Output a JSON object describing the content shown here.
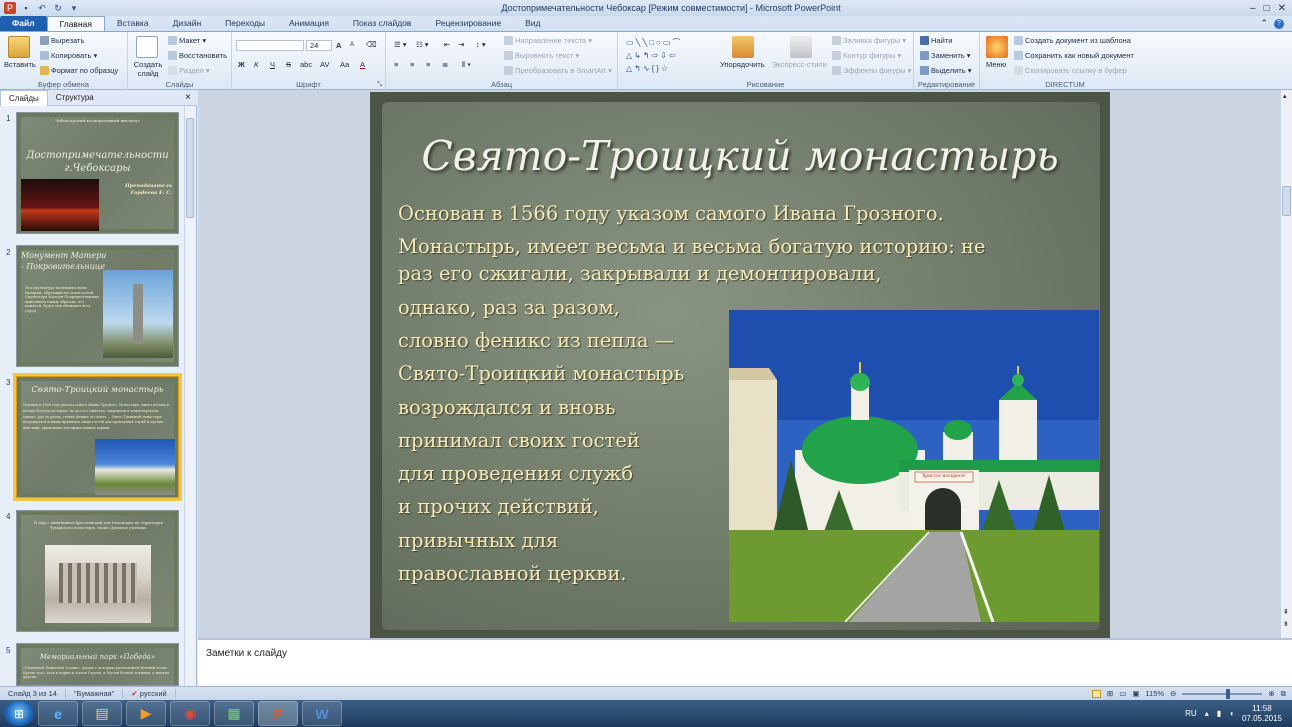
{
  "window": {
    "title": "Достопримечательности Чебоксар [Режим совместимости]  -  Microsoft PowerPoint"
  },
  "tabs": [
    {
      "label": "Файл"
    },
    {
      "label": "Главная"
    },
    {
      "label": "Вставка"
    },
    {
      "label": "Дизайн"
    },
    {
      "label": "Переходы"
    },
    {
      "label": "Анимация"
    },
    {
      "label": "Показ слайдов"
    },
    {
      "label": "Рецензирование"
    },
    {
      "label": "Вид"
    }
  ],
  "ribbon": {
    "clipboard": {
      "paste": "Вставить",
      "cut": "Вырезать",
      "copy": "Копировать",
      "format_painter": "Формат по образцу",
      "label": "Буфер обмена"
    },
    "slides": {
      "new_slide": "Создать слайд",
      "layout": "Макет",
      "reset": "Восстановить",
      "section": "Раздел",
      "label": "Слайды"
    },
    "font": {
      "size": "24",
      "label": "Шрифт",
      "bold": "Ж",
      "italic": "К",
      "underline": "Ч",
      "strike": "S",
      "shadow": "abc",
      "spacing": "AV",
      "case": "Aa",
      "color": "A",
      "grow": "A",
      "shrink": "A"
    },
    "paragraph": {
      "text_direction": "Направление текста",
      "align_text": "Выровнять текст",
      "smartart": "Преобразовать в SmartArt",
      "label": "Абзац"
    },
    "drawing": {
      "arrange": "Упорядочить",
      "quick_styles": "Экспресс-стили",
      "shape_fill": "Заливка фигуры",
      "shape_outline": "Контур фигуры",
      "shape_effects": "Эффекты фигуры",
      "label": "Рисование"
    },
    "editing": {
      "find": "Найти",
      "replace": "Заменить",
      "select": "Выделить",
      "label": "Редактирование"
    },
    "directum": {
      "menu": "Меню",
      "create_from_template": "Создать документ из шаблона",
      "save_new": "Сохранить как новый документ",
      "copy_link": "Скопировать ссылку в буфер",
      "label": "DIRECTUM"
    }
  },
  "left_panel": {
    "tab_slides": "Слайды",
    "tab_outline": "Структура",
    "close": "×",
    "thumbnails": [
      {
        "num": "1",
        "header": "Чебоксарский кооперативный институт",
        "title": "Достопримечательности г.Чебоксары",
        "author_label": "Преподаватель",
        "author": "Гордеева Е. С."
      },
      {
        "num": "2",
        "title": "Монумент Матери - Покровительнице",
        "text": "Эта скульптура посвящена всем матерям, обретшим на земле детей. Скульптура Матери-Покровительницы выполнена таким образом, что кажется, будто она обнимает весь город."
      },
      {
        "num": "3",
        "title": "Свято-Троицкий монастырь",
        "text": "Основан в 1566 году указом самого Ивана Грозного. Монастырь, имеет весьма и весьма богатую историю: не раз его сжигали, закрывали и демонтировали, однако, раз за разом, словно феникс из пепла — Свято-Троицкий монастырь возрождался и вновь принимал своих гостей для проведения служб и прочих действий, привычных для православной церкви."
      },
      {
        "num": "4",
        "text": "В саду с памятником Крестьянский дом Надеждина на территории Чувашского монастыря, также Духовное училище."
      },
      {
        "num": "5",
        "title": "Мемориальный парк «Победа»",
        "text": "«Монумент Воинской Славы», рядом с которым расположен Вечный огонь. Кроме того, есть в парке и Аллея Героев, и Музей боевой техники, а многие другие"
      }
    ]
  },
  "slide": {
    "title": "Свято-Троицкий монастырь",
    "lines": [
      "Основан в 1566 году указом самого Ивана Грозного.",
      "Монастырь, имеет весьма и весьма богатую историю: не",
      "раз его сжигали, закрывали и демонтировали,",
      "однако, раз за разом,",
      "словно феникс из пепла —",
      "Свято-Троицкий монастырь",
      "возрождался и вновь",
      "принимал своих гостей",
      "для проведения служб",
      "и прочих действий,",
      "привычных для",
      "православной церкви."
    ],
    "photo_sign": "Христос воскресе!"
  },
  "notes": {
    "placeholder": "Заметки к слайду"
  },
  "status": {
    "slide_counter": "Слайд 3 из 14",
    "theme": "\"Бумажная\"",
    "language": "русский",
    "zoom": "115%"
  },
  "taskbar": {
    "lang": "RU",
    "time": "11:58",
    "date": "07.05.2015"
  },
  "colors": {
    "accent": "#1f5fb0",
    "slide_text": "#f6e9b6",
    "selected_thumb": "#f4c542"
  }
}
